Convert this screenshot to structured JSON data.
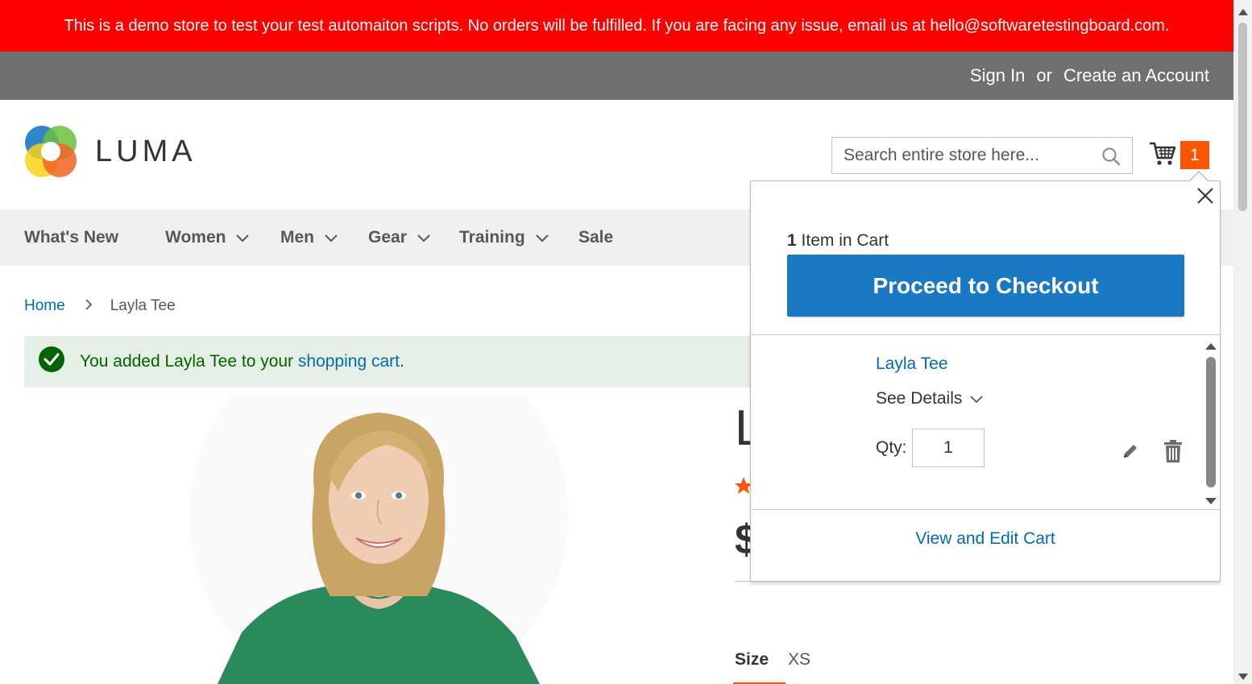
{
  "demo_notice": "This is a demo store to test your test automaiton scripts. No orders will be fulfilled. If you are facing any issue, email us at hello@softwaretestingboard.com.",
  "header": {
    "sign_in": "Sign In",
    "or": "or",
    "create_account": "Create an Account"
  },
  "logo": {
    "text": "LUMA"
  },
  "search": {
    "placeholder": "Search entire store here..."
  },
  "cart": {
    "counter": "1"
  },
  "nav": {
    "items": [
      {
        "label": "What's New",
        "has_dropdown": false
      },
      {
        "label": "Women",
        "has_dropdown": true
      },
      {
        "label": "Men",
        "has_dropdown": true
      },
      {
        "label": "Gear",
        "has_dropdown": true
      },
      {
        "label": "Training",
        "has_dropdown": true
      },
      {
        "label": "Sale",
        "has_dropdown": false
      }
    ]
  },
  "breadcrumb": {
    "home": "Home",
    "current": "Layla Tee"
  },
  "message": {
    "prefix": "You added Layla Tee to your ",
    "link": "shopping cart",
    "suffix": "."
  },
  "product": {
    "title_fragment": "L",
    "price_fragment": "$",
    "size_label": "Size",
    "size_value": "XS"
  },
  "minicart": {
    "count_number": "1",
    "count_text": " Item in Cart",
    "checkout_label": "Proceed to Checkout",
    "item": {
      "name": "Layla Tee",
      "see_details": "See Details",
      "qty_label": "Qty:",
      "qty_value": "1"
    },
    "view_cart": "View and Edit Cart"
  },
  "colors": {
    "demo_bar": "#ff0000",
    "header_panel": "#6e716e",
    "accent_blue": "#1979c3",
    "link_blue": "#006bb4",
    "cart_counter": "#ff5501",
    "success_bg": "#e5efe5",
    "success_text": "#006400"
  }
}
